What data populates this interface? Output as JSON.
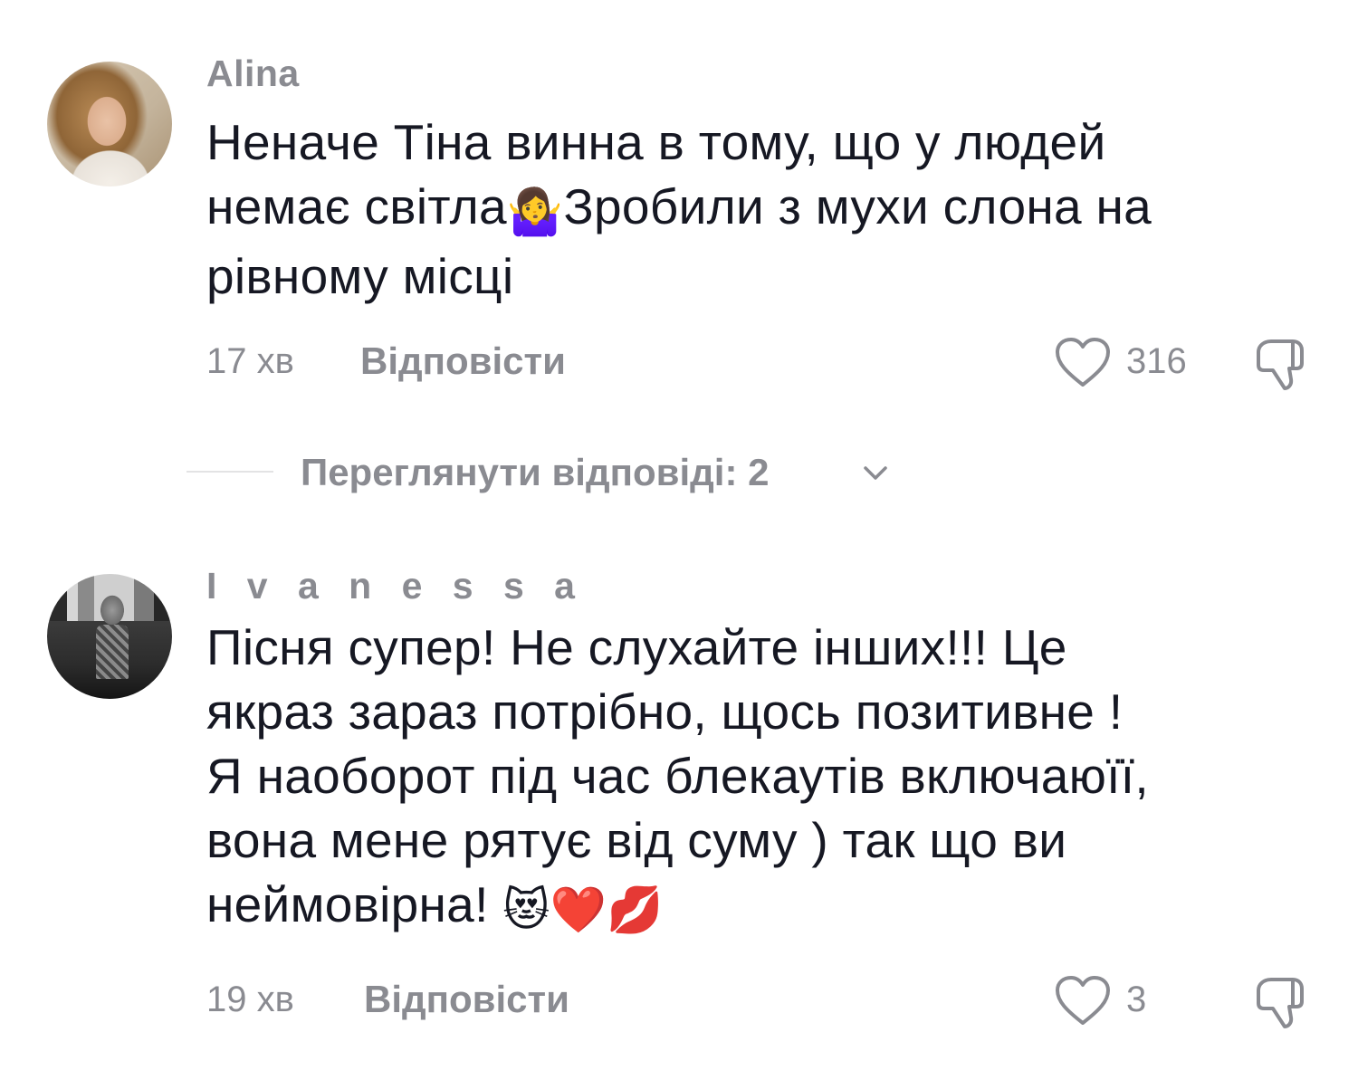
{
  "comments": [
    {
      "username": "Alina",
      "lines": [
        {
          "text": "Неначе Тіна винна в тому, що у людей"
        },
        {
          "text": "немає світла",
          "emoji": "🤷‍♀️",
          "tail": "Зробили з мухи слона на"
        },
        {
          "text": "рівному місці"
        }
      ],
      "time": "17 хв",
      "reply_label": "Відповісти",
      "likes": "316",
      "avatar_icon": "avatar-photo-icon"
    },
    {
      "username": "I v a n e s s a",
      "lines": [
        {
          "text": "Пісня супер! Не слухайте інших!!! Це"
        },
        {
          "text": "якраз зараз потрібно, щось позитивне !"
        },
        {
          "text": "Я наоборот під час блекаутів включаюїї,"
        },
        {
          "text": "вона мене рятує від суму ) так що ви"
        },
        {
          "text": "неймовірна! ",
          "emoji": "😻❤️💋"
        }
      ],
      "time": "19 хв",
      "reply_label": "Відповісти",
      "likes": "3",
      "avatar_icon": "avatar-photo-icon"
    }
  ],
  "view_replies": {
    "label": "Переглянути відповіді: 2"
  },
  "icons": {
    "like": "heart-outline-icon",
    "dislike": "thumbs-down-icon",
    "expand": "chevron-down-icon"
  },
  "colors": {
    "text": "#161823",
    "muted": "#8a8b91",
    "divider": "#e3e3e4"
  }
}
